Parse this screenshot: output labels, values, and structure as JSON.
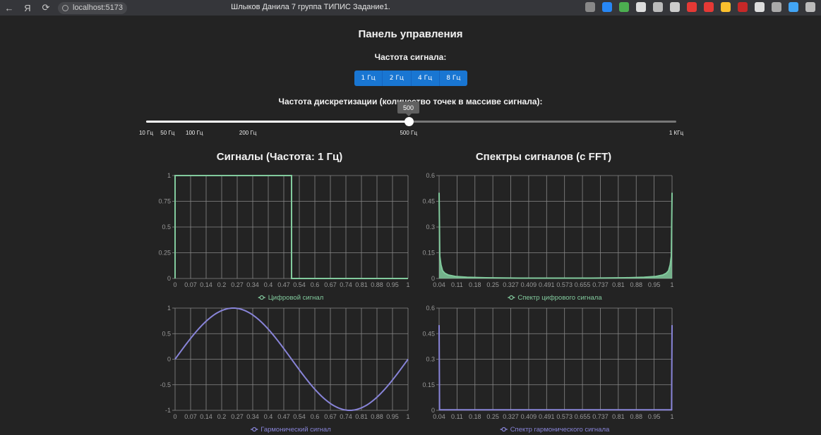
{
  "browser": {
    "address": "localhost:5173",
    "title": "Шлыков Данила 7 группа ТИПИС Задание1."
  },
  "panel": {
    "title": "Панель управления",
    "frequency_label": "Частота сигнала:",
    "frequency_buttons": [
      "1 Гц",
      "2 Гц",
      "4 Гц",
      "8 Гц"
    ],
    "sampling_label": "Частота дискретизации (количество точек в массиве сигнала):",
    "slider": {
      "value": 500,
      "value_label": "500",
      "min": 10,
      "max": 1000,
      "marks": [
        {
          "value": 10,
          "label": "10 Гц"
        },
        {
          "value": 50,
          "label": "50 Гц"
        },
        {
          "value": 100,
          "label": "100 Гц"
        },
        {
          "value": 200,
          "label": "200 Гц"
        },
        {
          "value": 500,
          "label": "500 Гц"
        },
        {
          "value": 1000,
          "label": "1 КГц"
        }
      ]
    }
  },
  "signals_title": "Сигналы (Частота: 1 Гц)",
  "spectra_title": "Спектры сигналов (с FFT)",
  "colors": {
    "digital": "#82ca9d",
    "harmonic": "#8884d8",
    "accent": "#1976d2",
    "grid": "#888888",
    "axis_text": "#999999"
  },
  "chart_data": [
    {
      "type": "line",
      "series": [
        {
          "name": "Цифровой сигнал"
        }
      ],
      "x_ticks": [
        "0",
        "0.07",
        "0.14",
        "0.2",
        "0.27",
        "0.34",
        "0.4",
        "0.47",
        "0.54",
        "0.6",
        "0.67",
        "0.74",
        "0.81",
        "0.88",
        "0.95",
        "1"
      ],
      "y_ticks": [
        "0",
        "0.25",
        "0.5",
        "0.75",
        "1"
      ],
      "xlim": [
        0,
        1
      ],
      "ylim": [
        0,
        1
      ],
      "points": [
        [
          0,
          0
        ],
        [
          0,
          1
        ],
        [
          0.5,
          1
        ],
        [
          0.5,
          0
        ],
        [
          1,
          0
        ]
      ]
    },
    {
      "type": "area",
      "series": [
        {
          "name": "Спектр цифрового сигнала"
        }
      ],
      "x_ticks": [
        "0.04",
        "0.11",
        "0.18",
        "0.25",
        "0.327",
        "0.409",
        "0.491",
        "0.573",
        "0.655",
        "0.737",
        "0.81",
        "0.88",
        "0.95",
        "1"
      ],
      "y_ticks": [
        "0",
        "0.15",
        "0.3",
        "0.45",
        "0.6"
      ],
      "xlim": [
        0,
        1
      ],
      "ylim": [
        0,
        0.6
      ],
      "points": [
        [
          0,
          0.5
        ],
        [
          0.003,
          0.13
        ],
        [
          0.008,
          0.08
        ],
        [
          0.015,
          0.045
        ],
        [
          0.025,
          0.03
        ],
        [
          0.04,
          0.02
        ],
        [
          0.07,
          0.012
        ],
        [
          0.12,
          0.007
        ],
        [
          0.2,
          0.004
        ],
        [
          0.35,
          0.002
        ],
        [
          0.5,
          0.002
        ],
        [
          0.65,
          0.002
        ],
        [
          0.8,
          0.004
        ],
        [
          0.88,
          0.007
        ],
        [
          0.93,
          0.012
        ],
        [
          0.96,
          0.02
        ],
        [
          0.975,
          0.03
        ],
        [
          0.985,
          0.045
        ],
        [
          0.992,
          0.08
        ],
        [
          0.997,
          0.13
        ],
        [
          1,
          0.5
        ]
      ]
    },
    {
      "type": "line",
      "series": [
        {
          "name": "Гармонический сигнал"
        }
      ],
      "x_ticks": [
        "0",
        "0.07",
        "0.14",
        "0.2",
        "0.27",
        "0.34",
        "0.4",
        "0.47",
        "0.54",
        "0.6",
        "0.67",
        "0.74",
        "0.81",
        "0.88",
        "0.95",
        "1"
      ],
      "y_ticks": [
        "-1",
        "-0.5",
        "0",
        "0.5",
        "1"
      ],
      "xlim": [
        0,
        1
      ],
      "ylim": [
        -1,
        1
      ],
      "function": "sin(2πx)"
    },
    {
      "type": "area",
      "series": [
        {
          "name": "Спектр гармонического сигнала"
        }
      ],
      "x_ticks": [
        "0.04",
        "0.11",
        "0.18",
        "0.25",
        "0.327",
        "0.409",
        "0.491",
        "0.573",
        "0.655",
        "0.737",
        "0.81",
        "0.88",
        "0.95",
        "1"
      ],
      "y_ticks": [
        "0",
        "0.15",
        "0.3",
        "0.45",
        "0.6"
      ],
      "xlim": [
        0,
        1
      ],
      "ylim": [
        0,
        0.6
      ],
      "points": [
        [
          0,
          0.5
        ],
        [
          0.002,
          0.003
        ],
        [
          0.998,
          0.003
        ],
        [
          1,
          0.5
        ]
      ]
    }
  ]
}
